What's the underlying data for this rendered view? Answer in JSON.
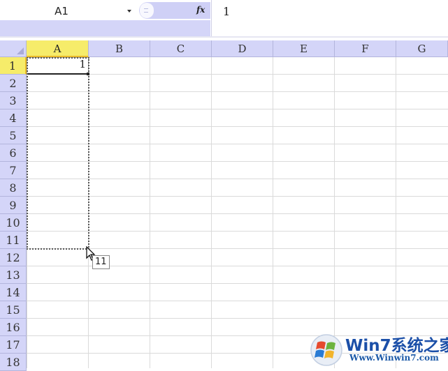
{
  "formula_bar": {
    "name_box_value": "A1",
    "formula_value": "1",
    "fx_label": "fx"
  },
  "sheet": {
    "columns": [
      "A",
      "B",
      "C",
      "D",
      "E",
      "F",
      "G"
    ],
    "rows": [
      "1",
      "2",
      "3",
      "4",
      "5",
      "6",
      "7",
      "8",
      "9",
      "10",
      "11",
      "12",
      "13",
      "14",
      "15",
      "16",
      "17",
      "18"
    ],
    "active_column": "A",
    "active_row": "1",
    "cells": {
      "A1": "1"
    },
    "selection": "A1:A11"
  },
  "fill_tooltip": {
    "value": "11"
  },
  "watermark": {
    "title": "Win7系统之家",
    "url": "Www.Winwin7.com"
  },
  "colors": {
    "header_bg": "#d4d5f8",
    "active_header_bg": "#f6ec6a",
    "gridline": "#dadada",
    "watermark_blue": "#1b4fa8"
  }
}
